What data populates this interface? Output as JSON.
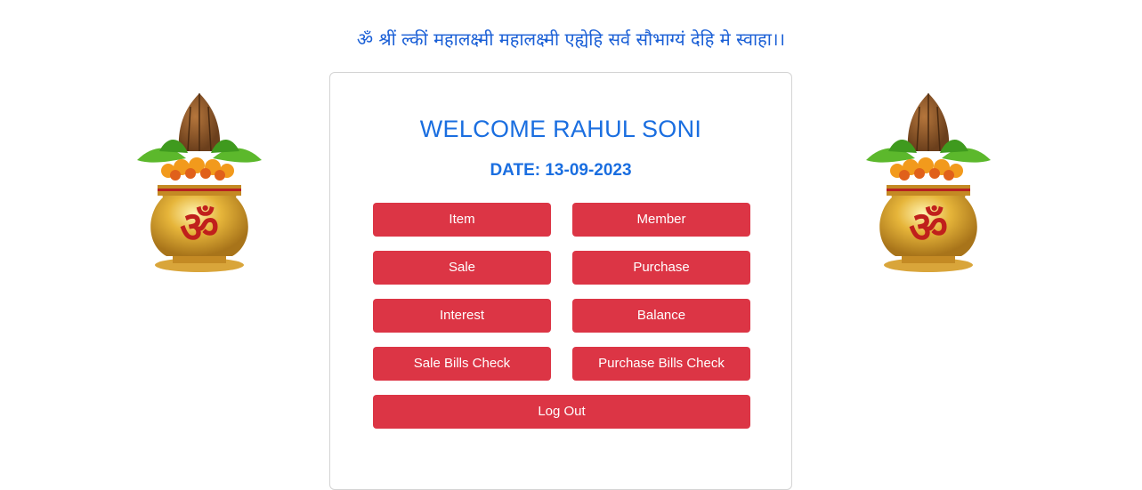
{
  "header": {
    "mantra": "ॐ श्रीं ल्कीं महालक्ष्मी महालक्ष्मी एह्येहि सर्व सौभाग्यं देहि मे स्वाहा।।"
  },
  "decor": {
    "left_image": "kalash-om-icon",
    "right_image": "kalash-om-icon"
  },
  "card": {
    "welcome": "WELCOME RAHUL SONI",
    "date": "DATE: 13-09-2023"
  },
  "buttons": {
    "item": "Item",
    "member": "Member",
    "sale": "Sale",
    "purchase": "Purchase",
    "interest": "Interest",
    "balance": "Balance",
    "sale_bills_check": "Sale Bills Check",
    "purchase_bills_check": "Purchase Bills Check",
    "logout": "Log Out"
  },
  "colors": {
    "accent_text": "#1a6ee0",
    "button_bg": "#dc3545",
    "button_text": "#ffffff"
  }
}
